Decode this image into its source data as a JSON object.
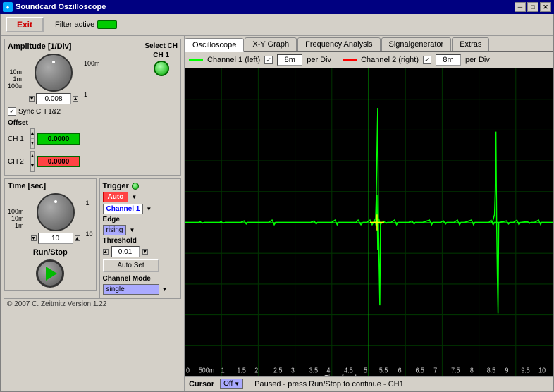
{
  "titlebar": {
    "title": "Soundcard Oszilloscope",
    "min_btn": "─",
    "max_btn": "□",
    "close_btn": "✕"
  },
  "topbar": {
    "exit_label": "Exit",
    "filter_label": "Filter active"
  },
  "tabs": [
    {
      "id": "oscilloscope",
      "label": "Oscilloscope",
      "active": true
    },
    {
      "id": "xy-graph",
      "label": "X-Y Graph",
      "active": false
    },
    {
      "id": "frequency-analysis",
      "label": "Frequency Analysis",
      "active": false
    },
    {
      "id": "signalgenerator",
      "label": "Signalgenerator",
      "active": false
    },
    {
      "id": "extras",
      "label": "Extras",
      "active": false
    }
  ],
  "channel_bar": {
    "ch1_label": "Channel 1 (left)",
    "ch1_checked": "✓",
    "ch1_perdiv": "8m",
    "ch1_perdiv_unit": "per Div",
    "ch2_label": "Channel 2 (right)",
    "ch2_checked": "✓",
    "ch2_perdiv": "8m",
    "ch2_perdiv_unit": "per Div"
  },
  "amplitude": {
    "title": "Amplitude [1/Div]",
    "select_ch_label": "Select CH",
    "ch1_label": "CH 1",
    "sync_label": "Sync CH 1&2",
    "sync_checked": "✓",
    "offset_label": "Offset",
    "ch1_offset_label": "CH 1",
    "ch1_offset_value": "0.0000",
    "ch2_offset_label": "CH 2",
    "ch2_offset_value": "0.0000",
    "labels_left": [
      "10m",
      "1m",
      "100u"
    ],
    "labels_right": [
      "100m",
      "1"
    ],
    "value": "0.008"
  },
  "time": {
    "title": "Time [sec]",
    "labels_left": [
      "100m",
      "10m",
      "1m"
    ],
    "labels_right": [
      "1",
      "10"
    ],
    "value": "10"
  },
  "trigger": {
    "title": "Trigger",
    "mode_label": "Auto",
    "channel_label": "Channel 1",
    "edge_label": "Edge",
    "edge_value": "rising",
    "threshold_label": "Threshold",
    "threshold_value": "0.01",
    "auto_set_label": "Auto Set",
    "channel_mode_label": "Channel Mode",
    "channel_mode_value": "single"
  },
  "run_stop": {
    "label": "Run/Stop"
  },
  "scope": {
    "x_labels": [
      "0",
      "500m",
      "1",
      "1.5",
      "2",
      "2.5",
      "3",
      "3.5",
      "4",
      "4.5",
      "5",
      "5.5",
      "6",
      "6.5",
      "7",
      "7.5",
      "8",
      "8.5",
      "9",
      "9.5",
      "10"
    ],
    "x_unit": "Time [sec]"
  },
  "cursor": {
    "label": "Cursor",
    "value": "Off"
  },
  "status": {
    "text": "Paused - press Run/Stop to continue - CH1"
  },
  "copyright": {
    "text": "© 2007  C. Zeitmitz Version 1.22"
  }
}
